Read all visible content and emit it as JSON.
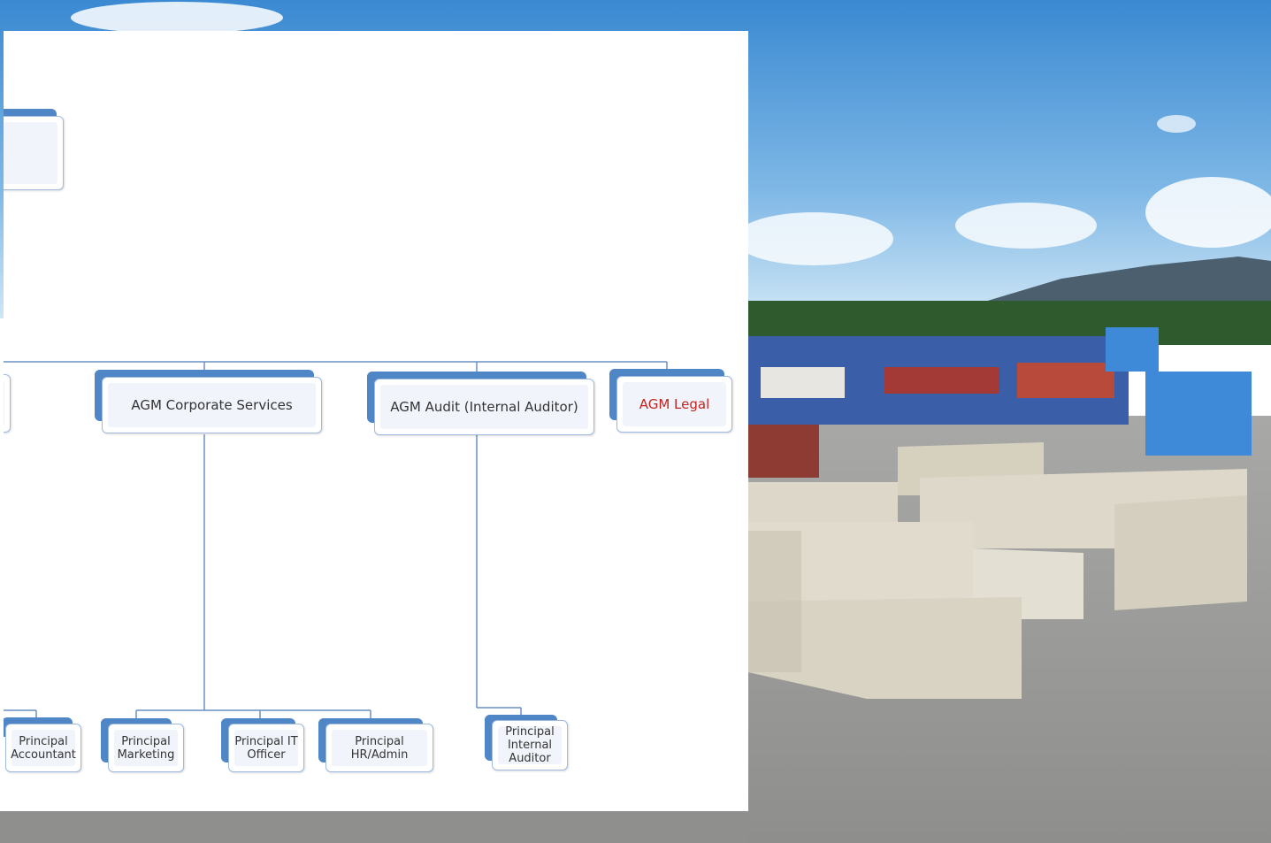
{
  "org_chart": {
    "level2": [
      {
        "label": "AGM Corporate  Services",
        "color": "#333333"
      },
      {
        "label": "AGM Audit  (Internal  Auditor)",
        "color": "#333333"
      },
      {
        "label": "AGM Legal",
        "color": "#c0251f"
      }
    ],
    "level3": [
      {
        "label": "Principal Accountant"
      },
      {
        "label": "Principal Marketing"
      },
      {
        "label": "Principal IT Officer"
      },
      {
        "label": "Principal HR/Admin"
      },
      {
        "label": "Principal Internal Auditor"
      }
    ]
  },
  "colors": {
    "node_tab": "#4f86c6",
    "node_border": "#9fbbe0",
    "connector": "#6a90c2",
    "sky_top": "#3d8fd6",
    "sky_bottom": "#a9d3f0"
  }
}
